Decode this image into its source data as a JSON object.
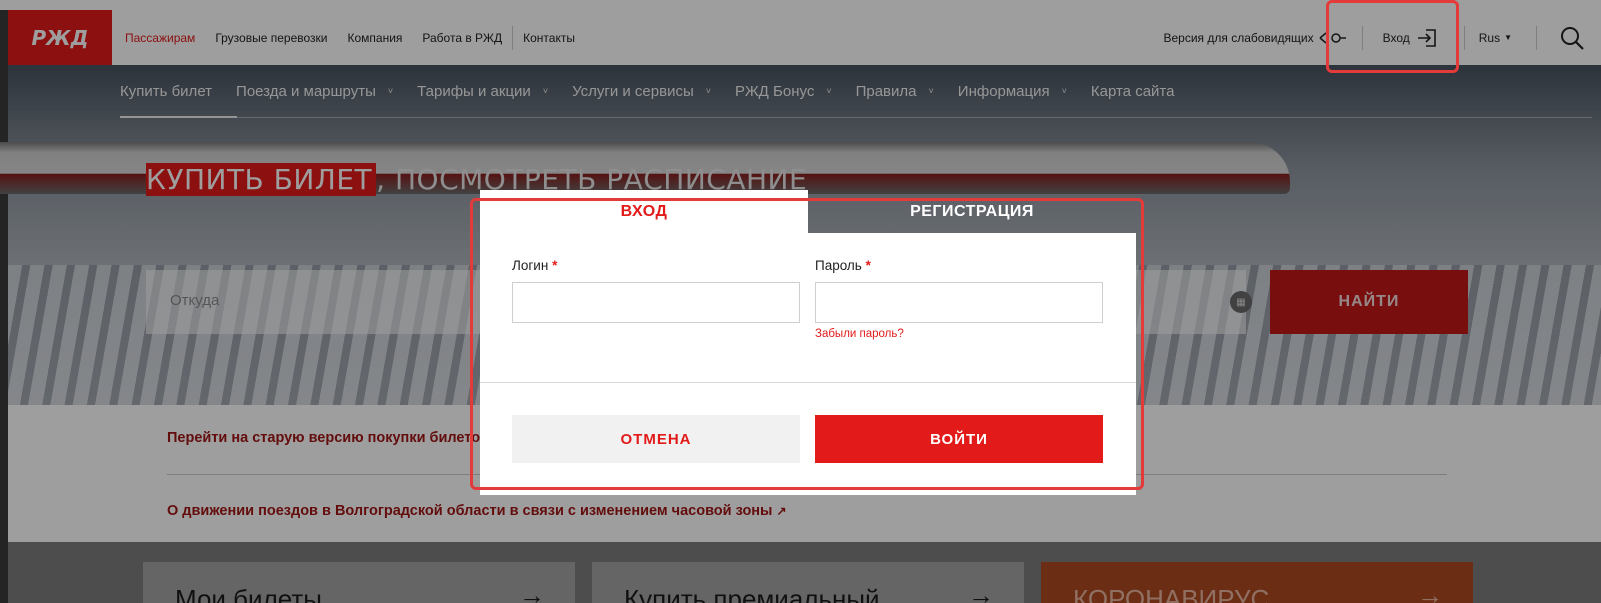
{
  "header": {
    "logo_text": "РЖД",
    "nav": [
      "Пассажирам",
      "Грузовые перевозки",
      "Компания",
      "Работа в РЖД",
      "Контакты"
    ],
    "accessibility_label": "Версия для слабовидящих",
    "login_label": "Вход",
    "lang_label": "Rus"
  },
  "subnav": {
    "items": [
      {
        "label": "Купить билет",
        "chevron": false
      },
      {
        "label": "Поезда и маршруты",
        "chevron": true
      },
      {
        "label": "Тарифы и акции",
        "chevron": true
      },
      {
        "label": "Услуги и сервисы",
        "chevron": true
      },
      {
        "label": "РЖД Бонус",
        "chevron": true
      },
      {
        "label": "Правила",
        "chevron": true
      },
      {
        "label": "Информация",
        "chevron": true
      },
      {
        "label": "Карта сайта",
        "chevron": false
      }
    ]
  },
  "hero": {
    "title_highlight": "КУПИТЬ БИЛЕТ",
    "title_rest": ", ПОСМОТРЕТЬ РАСПИСАНИЕ",
    "from_placeholder": "Откуда",
    "search_button": "НАЙТИ"
  },
  "notices": {
    "item1": "Перейти на старую версию покупки билетов",
    "item2": "О движении поездов в Волгоградской области в связи с изменением часовой зоны"
  },
  "cards": [
    "Мои билеты",
    "Купить премиальный",
    "КОРОНАВИРУС"
  ],
  "modal": {
    "tab_login": "ВХОД",
    "tab_register": "РЕГИСТРАЦИЯ",
    "login_label": "Логин",
    "password_label": "Пароль",
    "required_mark": "*",
    "login_value": "",
    "password_value": "",
    "forgot_link": "Забыли пароль?",
    "cancel_button": "ОТМЕНА",
    "submit_button": "ВОЙТИ"
  },
  "colors": {
    "brand_red": "#e21a1a",
    "highlight_box": "#e33a3a"
  }
}
